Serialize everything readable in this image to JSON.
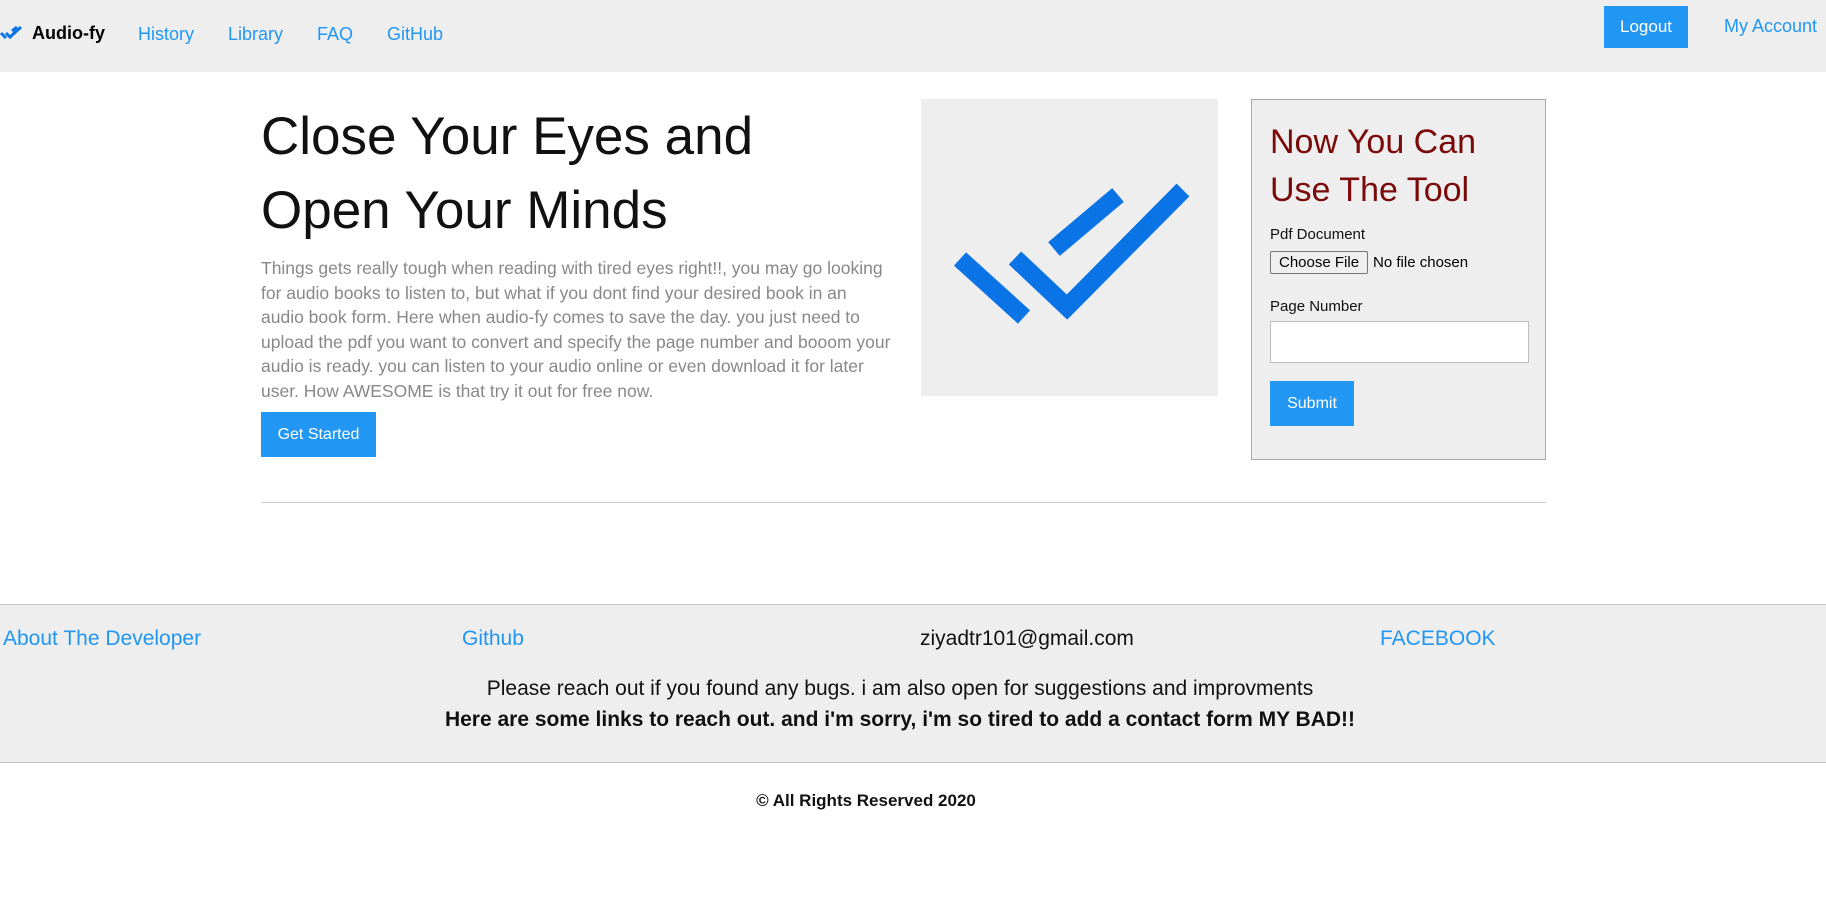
{
  "navbar": {
    "brand": "Audio-fy",
    "links": [
      "History",
      "Library",
      "FAQ",
      "GitHub"
    ],
    "logout_label": "Logout",
    "account_label": "My Account",
    "icon": "double-check-icon"
  },
  "hero": {
    "title_line1": "Close Your Eyes and",
    "title_line2": "Open Your Minds",
    "description": "Things gets really tough when reading with tired eyes right!!, you may go looking for audio books to listen to, but what if you dont find your desired book in an audio book form. Here when audio-fy comes to save the day. you just need to upload the pdf you want to convert and specify the page number and booom your audio is ready. you can listen to your audio online or even download it for later user. How AWESOME is that try it out for free now.",
    "cta_label": "Get Started",
    "image_icon": "double-check-icon"
  },
  "tool": {
    "title": "Now You Can Use The Tool",
    "pdf_label": "Pdf Document",
    "file_button": "Choose File",
    "file_status": "No file chosen",
    "page_label": "Page Number",
    "page_value": "",
    "submit_label": "Submit"
  },
  "footer": {
    "about": "About The Developer",
    "github": "Github",
    "email": "ziyadtr101@gmail.com",
    "facebook": "FACEBOOK",
    "message1": "Please reach out if you found any bugs. i am also open for suggestions and improvments",
    "message2": "Here are some links to reach out. and i'm sorry, i'm so tired to add a contact form MY BAD!!",
    "copyright": "© All Rights Reserved 2020"
  },
  "colors": {
    "accent": "#2196f3",
    "logo_blue": "#0a73e6",
    "tool_title": "#7a0a0a",
    "panel_bg": "#eeeeee",
    "muted_text": "#888888"
  }
}
